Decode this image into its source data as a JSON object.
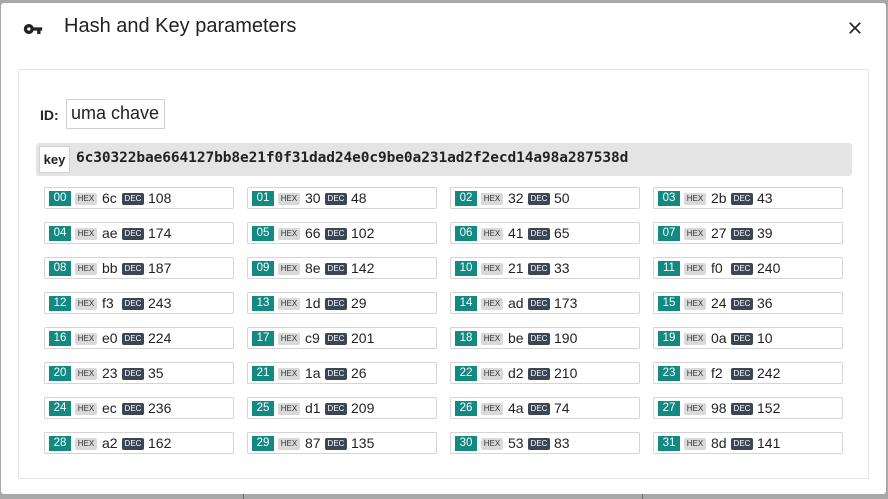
{
  "dialog": {
    "title": "Hash and Key parameters",
    "icon": "key-icon",
    "close_icon": "close-icon"
  },
  "id_field": {
    "label": "ID:",
    "value": "uma chave"
  },
  "key": {
    "label": "key",
    "value": "6c30322bae664127bb8e21f0f31dad24e0c9be0a231ad2f2ecd14a98a287538d"
  },
  "tags": {
    "hex": "HEX",
    "dec": "DEC"
  },
  "bytes": [
    {
      "index": "00",
      "hex": "6c",
      "dec": "108"
    },
    {
      "index": "01",
      "hex": "30",
      "dec": "48"
    },
    {
      "index": "02",
      "hex": "32",
      "dec": "50"
    },
    {
      "index": "03",
      "hex": "2b",
      "dec": "43"
    },
    {
      "index": "04",
      "hex": "ae",
      "dec": "174"
    },
    {
      "index": "05",
      "hex": "66",
      "dec": "102"
    },
    {
      "index": "06",
      "hex": "41",
      "dec": "65"
    },
    {
      "index": "07",
      "hex": "27",
      "dec": "39"
    },
    {
      "index": "08",
      "hex": "bb",
      "dec": "187"
    },
    {
      "index": "09",
      "hex": "8e",
      "dec": "142"
    },
    {
      "index": "10",
      "hex": "21",
      "dec": "33"
    },
    {
      "index": "11",
      "hex": "f0",
      "dec": "240"
    },
    {
      "index": "12",
      "hex": "f3",
      "dec": "243"
    },
    {
      "index": "13",
      "hex": "1d",
      "dec": "29"
    },
    {
      "index": "14",
      "hex": "ad",
      "dec": "173"
    },
    {
      "index": "15",
      "hex": "24",
      "dec": "36"
    },
    {
      "index": "16",
      "hex": "e0",
      "dec": "224"
    },
    {
      "index": "17",
      "hex": "c9",
      "dec": "201"
    },
    {
      "index": "18",
      "hex": "be",
      "dec": "190"
    },
    {
      "index": "19",
      "hex": "0a",
      "dec": "10"
    },
    {
      "index": "20",
      "hex": "23",
      "dec": "35"
    },
    {
      "index": "21",
      "hex": "1a",
      "dec": "26"
    },
    {
      "index": "22",
      "hex": "d2",
      "dec": "210"
    },
    {
      "index": "23",
      "hex": "f2",
      "dec": "242"
    },
    {
      "index": "24",
      "hex": "ec",
      "dec": "236"
    },
    {
      "index": "25",
      "hex": "d1",
      "dec": "209"
    },
    {
      "index": "26",
      "hex": "4a",
      "dec": "74"
    },
    {
      "index": "27",
      "hex": "98",
      "dec": "152"
    },
    {
      "index": "28",
      "hex": "a2",
      "dec": "162"
    },
    {
      "index": "29",
      "hex": "87",
      "dec": "135"
    },
    {
      "index": "30",
      "hex": "53",
      "dec": "83"
    },
    {
      "index": "31",
      "hex": "8d",
      "dec": "141"
    }
  ],
  "colors": {
    "index_badge": "#128a82",
    "dec_tag": "#3c4553",
    "hex_tag": "#d9d9d9",
    "key_bar": "#e4e4e4"
  }
}
